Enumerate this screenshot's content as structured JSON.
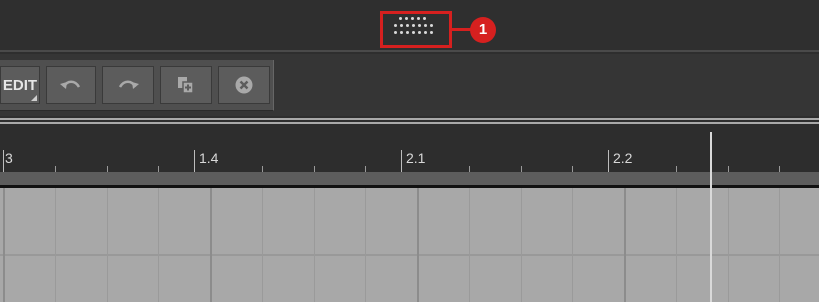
{
  "toolbar": {
    "edit_label": "EDIT",
    "buttons": [
      {
        "name": "undo",
        "icon": "undo-icon"
      },
      {
        "name": "redo",
        "icon": "redo-icon"
      },
      {
        "name": "duplicate",
        "icon": "duplicate-icon"
      },
      {
        "name": "clear",
        "icon": "clear-icon"
      }
    ]
  },
  "callout": {
    "number": "1",
    "color": "#d6201f"
  },
  "ruler": {
    "labels": [
      "3",
      "1.4",
      "2.1",
      "2.2"
    ]
  },
  "colors": {
    "background": "#2e2e2e",
    "toolbar": "#4f4f4f",
    "grid": "#a8a8a8"
  }
}
